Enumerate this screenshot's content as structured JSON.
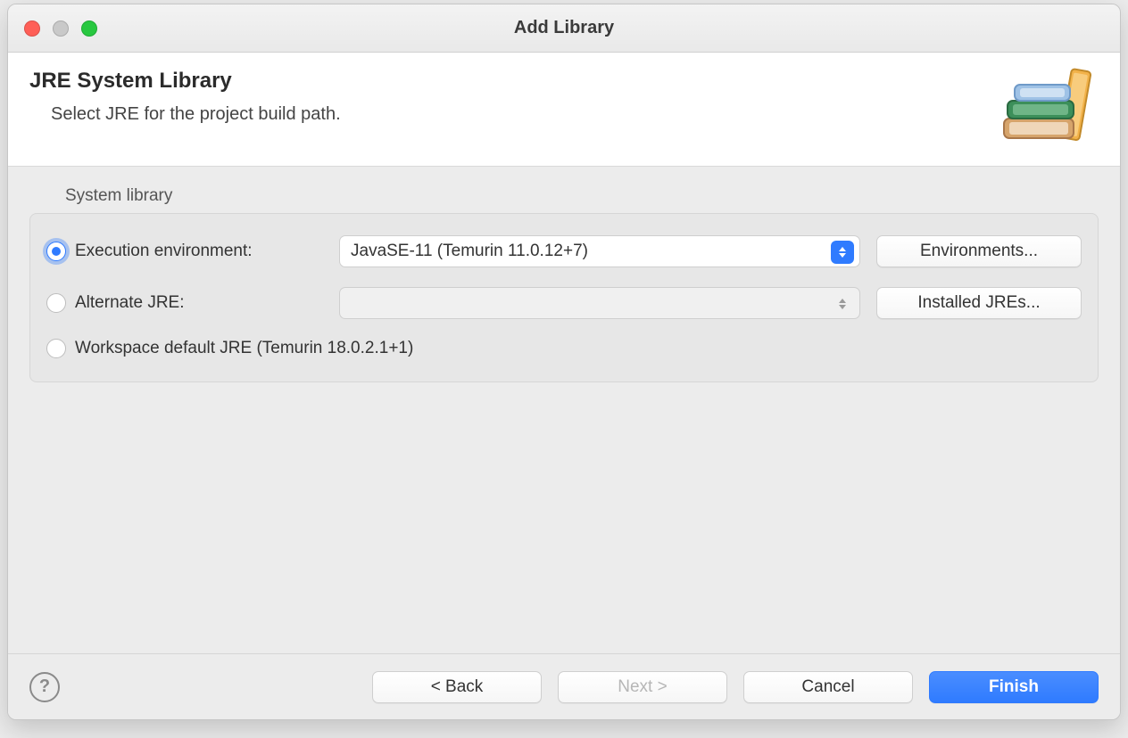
{
  "titlebar": {
    "title": "Add Library"
  },
  "banner": {
    "heading": "JRE System Library",
    "subtext": "Select JRE for the project build path."
  },
  "group": {
    "label": "System library",
    "exec_env": {
      "radio_label": "Execution environment:",
      "select_value": "JavaSE-11 (Temurin 11.0.12+7)",
      "button_label": "Environments..."
    },
    "alt_jre": {
      "radio_label": "Alternate JRE:",
      "select_value": "",
      "button_label": "Installed JREs..."
    },
    "workspace_default": {
      "radio_label": "Workspace default JRE (Temurin 18.0.2.1+1)"
    }
  },
  "footer": {
    "back": "< Back",
    "next": "Next >",
    "cancel": "Cancel",
    "finish": "Finish"
  }
}
